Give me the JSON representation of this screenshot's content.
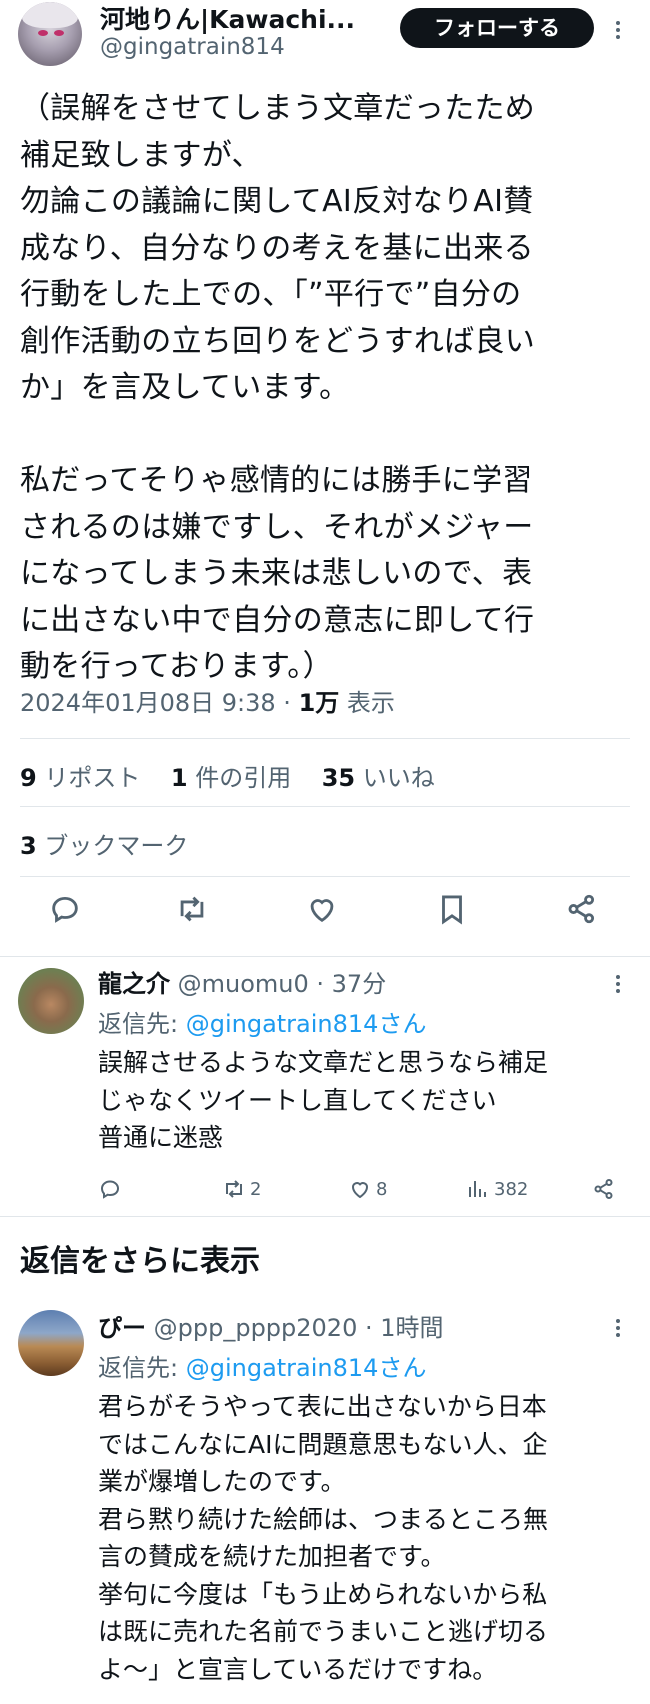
{
  "main": {
    "author_name": "河地りん|Kawachi...",
    "author_handle": "@gingatrain814",
    "follow_label": "フォローする",
    "body": "（誤解をさせてしまう文章だったため\n補足致しますが、\n勿論この議論に関してAI反対なりAI賛\n成なり、自分なりの考えを基に出来る\n行動をした上での、「”平行で”自分の\n創作活動の立ち回りをどうすれば良い\nか」を言及しています。\n\n私だってそりゃ感情的には勝手に学習\nされるのは嫌ですし、それがメジャー\nになってしまう未来は悲しいので、表\nに出さない中で自分の意志に即して行\n動を行っております。）",
    "timestamp": "2024年01月08日 9:38 · ",
    "views_count": "1万",
    "views_label": " 表示",
    "reposts_count": "9",
    "reposts_label": " リポスト",
    "quotes_count": "1",
    "quotes_label": " 件の引用",
    "likes_count": "35",
    "likes_label": " いいね",
    "bookmarks_count": "3",
    "bookmarks_label": " ブックマーク"
  },
  "replies": [
    {
      "name": "龍之介",
      "handle": " @muomu0 · 37分",
      "reply_to_prefix": "返信先: ",
      "reply_to_link": "@gingatrain814さん",
      "body": "誤解させるような文章だと思うなら補足\nじゃなくツイートし直してください\n普通に迷惑",
      "retweets": "2",
      "likes": "8",
      "views": "382"
    },
    {
      "name": "ぴー",
      "handle": " @ppp_pppp2020 · 1時間",
      "reply_to_prefix": "返信先: ",
      "reply_to_link": "@gingatrain814さん",
      "body": "君らがそうやって表に出さないから日本\nではこんなにAIに問題意思もない人、企\n業が爆増したのです。\n君ら黙り続けた絵師は、つまるところ無\n言の賛成を続けた加担者です。\n挙句に今度は「もう止められないから私\nは既に売れた名前でうまいこと逃げ切る\nよ〜」と宣言しているだけですね。"
    }
  ],
  "show_more_replies": "返信をさらに表示",
  "icons": {
    "reply": "reply-icon",
    "retweet": "retweet-icon",
    "like": "heart-icon",
    "bookmark": "bookmark-icon",
    "share": "share-icon",
    "views": "views-icon",
    "more": "more-icon"
  },
  "colors": {
    "link": "#1d9bf0",
    "muted": "#536471",
    "text": "#0f1419",
    "follow_bg": "#0f1419"
  }
}
